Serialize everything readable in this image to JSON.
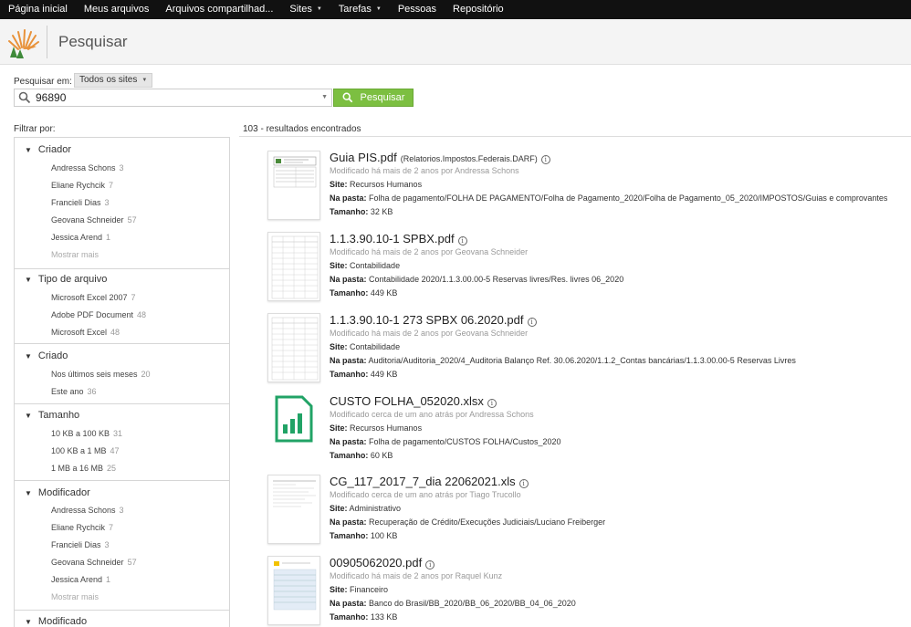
{
  "nav": {
    "items": [
      {
        "label": "Página inicial",
        "caret": false
      },
      {
        "label": "Meus arquivos",
        "caret": false
      },
      {
        "label": "Arquivos compartilhad...",
        "caret": false
      },
      {
        "label": "Sites",
        "caret": true
      },
      {
        "label": "Tarefas",
        "caret": true
      },
      {
        "label": "Pessoas",
        "caret": false
      },
      {
        "label": "Repositório",
        "caret": false
      }
    ]
  },
  "header": {
    "title": "Pesquisar"
  },
  "search": {
    "scope_label": "Pesquisar em:",
    "scope_value": "Todos os sites",
    "query": "96890",
    "button_label": "Pesquisar"
  },
  "filters": {
    "label": "Filtrar por:",
    "facets": [
      {
        "title": "Criador",
        "items": [
          {
            "label": "Andressa Schons",
            "count": "3"
          },
          {
            "label": "Eliane Rychcik",
            "count": "7"
          },
          {
            "label": "Francieli Dias",
            "count": "3"
          },
          {
            "label": "Geovana Schneider",
            "count": "57"
          },
          {
            "label": "Jessica Arend",
            "count": "1"
          }
        ],
        "more": "Mostrar mais"
      },
      {
        "title": "Tipo de arquivo",
        "items": [
          {
            "label": "Microsoft Excel 2007",
            "count": "7"
          },
          {
            "label": "Adobe PDF Document",
            "count": "48"
          },
          {
            "label": "Microsoft Excel",
            "count": "48"
          }
        ]
      },
      {
        "title": "Criado",
        "items": [
          {
            "label": "Nos últimos seis meses",
            "count": "20"
          },
          {
            "label": "Este ano",
            "count": "36"
          }
        ]
      },
      {
        "title": "Tamanho",
        "items": [
          {
            "label": "10 KB a 100 KB",
            "count": "31"
          },
          {
            "label": "100 KB a 1 MB",
            "count": "47"
          },
          {
            "label": "1 MB a 16 MB",
            "count": "25"
          }
        ]
      },
      {
        "title": "Modificador",
        "items": [
          {
            "label": "Andressa Schons",
            "count": "3"
          },
          {
            "label": "Eliane Rychcik",
            "count": "7"
          },
          {
            "label": "Francieli Dias",
            "count": "3"
          },
          {
            "label": "Geovana Schneider",
            "count": "57"
          },
          {
            "label": "Jessica Arend",
            "count": "1"
          }
        ],
        "more": "Mostrar mais"
      },
      {
        "title": "Modificado",
        "items": []
      }
    ]
  },
  "results": {
    "count_text": "103 - resultados encontrados",
    "labels": {
      "site": "Site:",
      "folder": "Na pasta:",
      "size": "Tamanho:"
    },
    "items": [
      {
        "name": "Guia PIS.pdf",
        "path": "(Relatorios.Impostos.Federais.DARF)",
        "modified": "Modificado há mais de 2 anos por Andressa Schons",
        "site": "Recursos Humanos",
        "folder": "Folha de pagamento/FOLHA DE PAGAMENTO/Folha de Pagamento_2020/Folha de Pagamento_05_2020/IMPOSTOS/Guias e comprovantes",
        "size": "32 KB",
        "thumb": "form"
      },
      {
        "name": "1.1.3.90.10-1 SPBX.pdf",
        "path": "",
        "modified": "Modificado há mais de 2 anos por Geovana Schneider",
        "site": "Contabilidade",
        "folder": "Contabilidade 2020/1.1.3.00.00-5 Reservas livres/Res. livres 06_2020",
        "size": "449 KB",
        "thumb": "table"
      },
      {
        "name": "1.1.3.90.10-1 273 SPBX 06.2020.pdf",
        "path": "",
        "modified": "Modificado há mais de 2 anos por Geovana Schneider",
        "site": "Contabilidade",
        "folder": "Auditoria/Auditoria_2020/4_Auditoria Balanço Ref. 30.06.2020/1.1.2_Contas bancárias/1.1.3.00.00-5 Reservas Livres",
        "size": "449 KB",
        "thumb": "table"
      },
      {
        "name": "CUSTO FOLHA_052020.xlsx",
        "path": "",
        "modified": "Modificado cerca de um ano atrás por Andressa Schons",
        "site": "Recursos Humanos",
        "folder": "Folha de pagamento/CUSTOS FOLHA/Custos_2020",
        "size": "60 KB",
        "thumb": "xlsx"
      },
      {
        "name": "CG_117_2017_7_dia 22062021.xls",
        "path": "",
        "modified": "Modificado cerca de um ano atrás por Tiago Trucollo",
        "site": "Administrativo",
        "folder": "Recuperação de Crédito/Execuções Judiciais/Luciano Freiberger",
        "size": "100 KB",
        "thumb": "doc"
      },
      {
        "name": "00905062020.pdf",
        "path": "",
        "modified": "Modificado há mais de 2 anos por Raquel Kunz",
        "site": "Financeiro",
        "folder": "Banco do Brasil/BB_2020/BB_06_2020/BB_04_06_2020",
        "size": "133 KB",
        "thumb": "bank"
      }
    ]
  }
}
